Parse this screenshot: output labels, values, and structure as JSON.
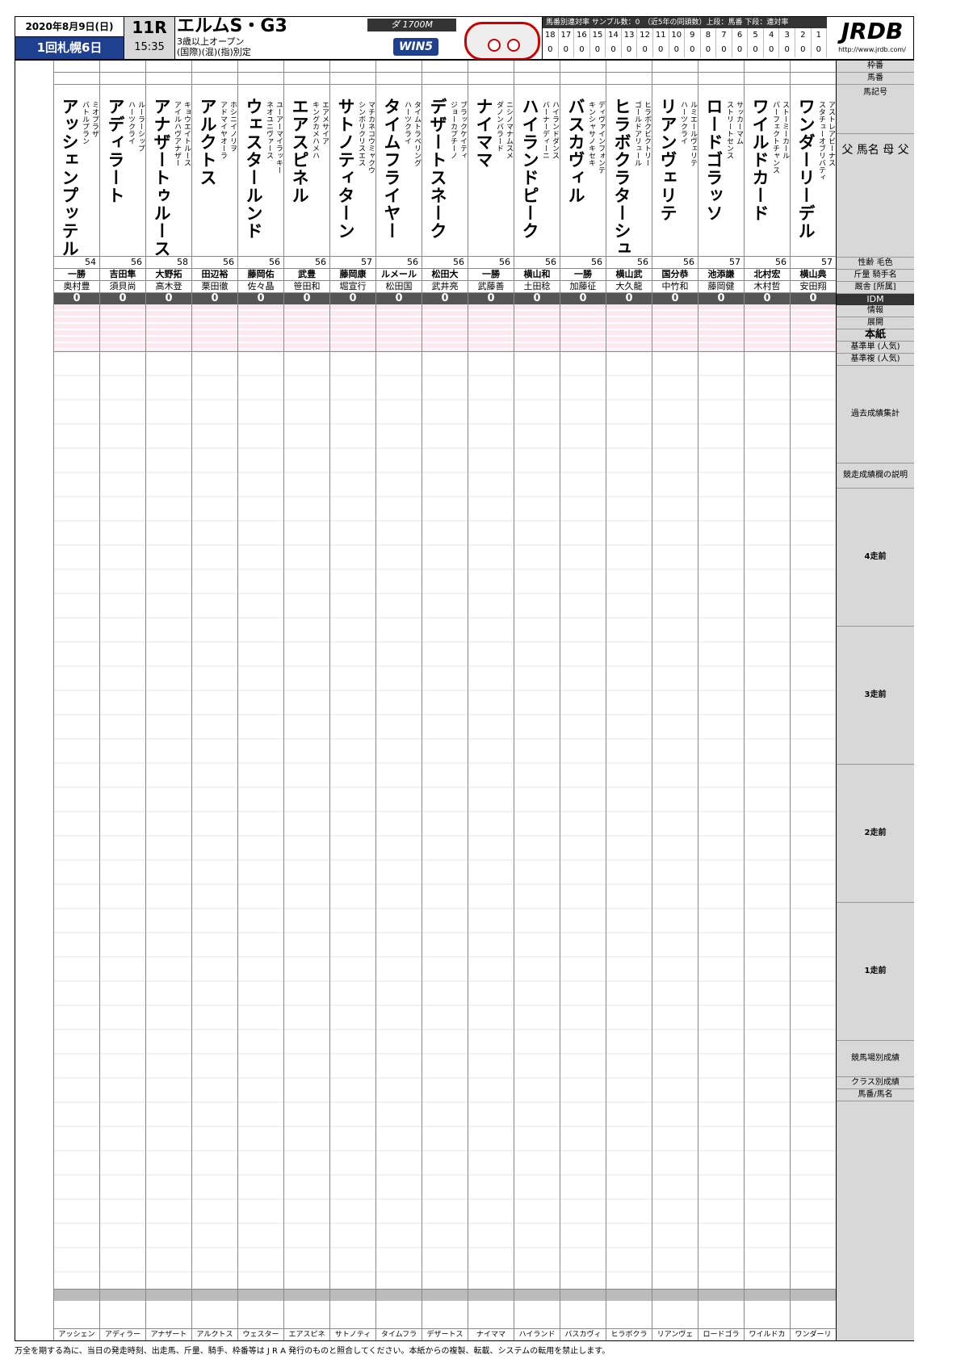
{
  "header": {
    "date": "2020年8月9日(日)",
    "meeting": "1回札幌6日",
    "race_no": "11R",
    "time": "15:35",
    "title": "エルムS・G3",
    "sub1": "3歳以上オープン",
    "sub2": "(国際)(混)(指)別定",
    "distance": "ダ 1700M",
    "win5": "WIN5",
    "stats_header": "馬番別連対率 サンプル数：0　（近5年の同頭数）上段：馬番 下段：連対率",
    "stats_nums": [
      "18",
      "17",
      "16",
      "15",
      "14",
      "13",
      "12",
      "11",
      "10",
      "9",
      "8",
      "7",
      "6",
      "5",
      "4",
      "3",
      "2",
      "1"
    ],
    "stats_vals": [
      "0",
      "0",
      "0",
      "0",
      "0",
      "0",
      "0",
      "0",
      "0",
      "0",
      "0",
      "0",
      "0",
      "0",
      "0",
      "0",
      "0",
      "0"
    ],
    "logo": "JRDB",
    "logo_url": "http://www.jrdb.com/"
  },
  "horses": [
    {
      "name": "ワンダーリーデル",
      "sire": "スタチューオブリバティ",
      "dam": "アストレアビーナス",
      "weight": "57",
      "jockey": "横山典",
      "trainer": "安田翔",
      "idm": "0",
      "foot": "ワンダーリ"
    },
    {
      "name": "ワイルドカード",
      "sire": "パーフェクトチャンス",
      "dam": "ストーミーカール",
      "weight": "56",
      "jockey": "北村宏",
      "trainer": "木村哲",
      "idm": "0",
      "foot": "ワイルドカ"
    },
    {
      "name": "ロードゴラッソ",
      "sire": "ストリートセンス",
      "dam": "サッカーマム",
      "weight": "57",
      "jockey": "池添謙",
      "trainer": "藤岡健",
      "idm": "0",
      "foot": "ロードゴラ"
    },
    {
      "name": "リアンヴェリテ",
      "sire": "ハーツクライ",
      "dam": "ルミエールヴェリテ",
      "weight": "56",
      "jockey": "国分恭",
      "trainer": "中竹和",
      "idm": "0",
      "foot": "リアンヴェ"
    },
    {
      "name": "ヒラボクラターシュ",
      "sire": "ゴールドアリュール",
      "dam": "ヒラボクビクトリー",
      "weight": "56",
      "jockey": "横山武",
      "trainer": "大久龍",
      "idm": "0",
      "foot": "ヒラボクラ"
    },
    {
      "name": "バスカヴィル",
      "sire": "キンシャサノキセキ",
      "dam": "ディヴァインフォンテ",
      "weight": "56",
      "jockey": "一勝",
      "trainer": "加藤征",
      "idm": "0",
      "foot": "バスカヴィ"
    },
    {
      "name": "ハイランドピーク",
      "sire": "バーナーディーニ",
      "dam": "ハイランドダンス",
      "weight": "56",
      "jockey": "横山和",
      "trainer": "土田稔",
      "idm": "0",
      "foot": "ハイランド"
    },
    {
      "name": "ナイママ",
      "sire": "ダノンバラード",
      "dam": "ニシノマナムスメ",
      "weight": "56",
      "jockey": "一勝",
      "trainer": "武藤善",
      "idm": "0",
      "foot": "ナイママ"
    },
    {
      "name": "デザートスネーク",
      "sire": "ジョーカプチーノ",
      "dam": "ブラックケイティ",
      "weight": "56",
      "jockey": "松田大",
      "trainer": "武井亮",
      "idm": "0",
      "foot": "デザートス"
    },
    {
      "name": "タイムフライヤー",
      "sire": "ハーツクライ",
      "dam": "タイムトラベリング",
      "weight": "56",
      "jockey": "ルメール",
      "trainer": "松田国",
      "idm": "0",
      "foot": "タイムフラ"
    },
    {
      "name": "サトノティターン",
      "sire": "シンボリクリスエス",
      "dam": "マチカネコウミャクウ",
      "weight": "57",
      "jockey": "藤岡康",
      "trainer": "堀宣行",
      "idm": "0",
      "foot": "サトノティ"
    },
    {
      "name": "エアスピネル",
      "sire": "キングカメハメハ",
      "dam": "エアメサイア",
      "weight": "56",
      "jockey": "武豊",
      "trainer": "笹田和",
      "idm": "0",
      "foot": "エアスピネ"
    },
    {
      "name": "ウェスタールンド",
      "sire": "ネオユニヴァース",
      "dam": "ユーアーマイラッキー",
      "weight": "56",
      "jockey": "藤岡佑",
      "trainer": "佐々晶",
      "idm": "0",
      "foot": "ウェスター"
    },
    {
      "name": "アルクトス",
      "sire": "アドマイヤオーラ",
      "dam": "ホシニイノリヲ",
      "weight": "56",
      "jockey": "田辺裕",
      "trainer": "栗田徹",
      "idm": "0",
      "foot": "アルクトス"
    },
    {
      "name": "アナザートゥルース",
      "sire": "アイルハヴアナザー",
      "dam": "キョウエイトルース",
      "weight": "58",
      "jockey": "大野拓",
      "trainer": "高木登",
      "idm": "0",
      "foot": "アナザート"
    },
    {
      "name": "アディラート",
      "sire": "ハーツクライ",
      "dam": "ルーラーシップ",
      "weight": "56",
      "jockey": "吉田隼",
      "trainer": "須貝尚",
      "idm": "0",
      "foot": "アディラー"
    },
    {
      "name": "アッシェンプッテル",
      "sire": "バトルプラン",
      "dam": "ミオプラザ",
      "weight": "54",
      "jockey": "一勝",
      "trainer": "奥村豊",
      "idm": "0",
      "foot": "アッシェン"
    }
  ],
  "side": {
    "gate": "枠番",
    "num": "馬番",
    "mark": "馬記号",
    "names": "父 馬名 母 父",
    "sex": "性齢 毛色",
    "weight": "斤量 騎手名",
    "trainer": "厩舎 [所属]",
    "idm": "IDM",
    "info": "情報",
    "tenkai": "展開",
    "honshi": "本紙",
    "base1": "基準単 (人気)",
    "base2": "基準複 (人気)",
    "past": "過去成績集計",
    "past1": "競走成績欄の説明",
    "row4": "4走前",
    "row3": "3走前",
    "row2": "2走前",
    "row1": "1走前",
    "track": "競馬場別成績",
    "class": "クラス別成績",
    "foot": "馬番/馬名"
  },
  "footnote": "万全を期する為に、当日の発走時刻、出走馬、斤量、騎手、枠番等は J R A 発行のものと照合してください。本紙からの複製、転載、システムの転用を禁止します。"
}
